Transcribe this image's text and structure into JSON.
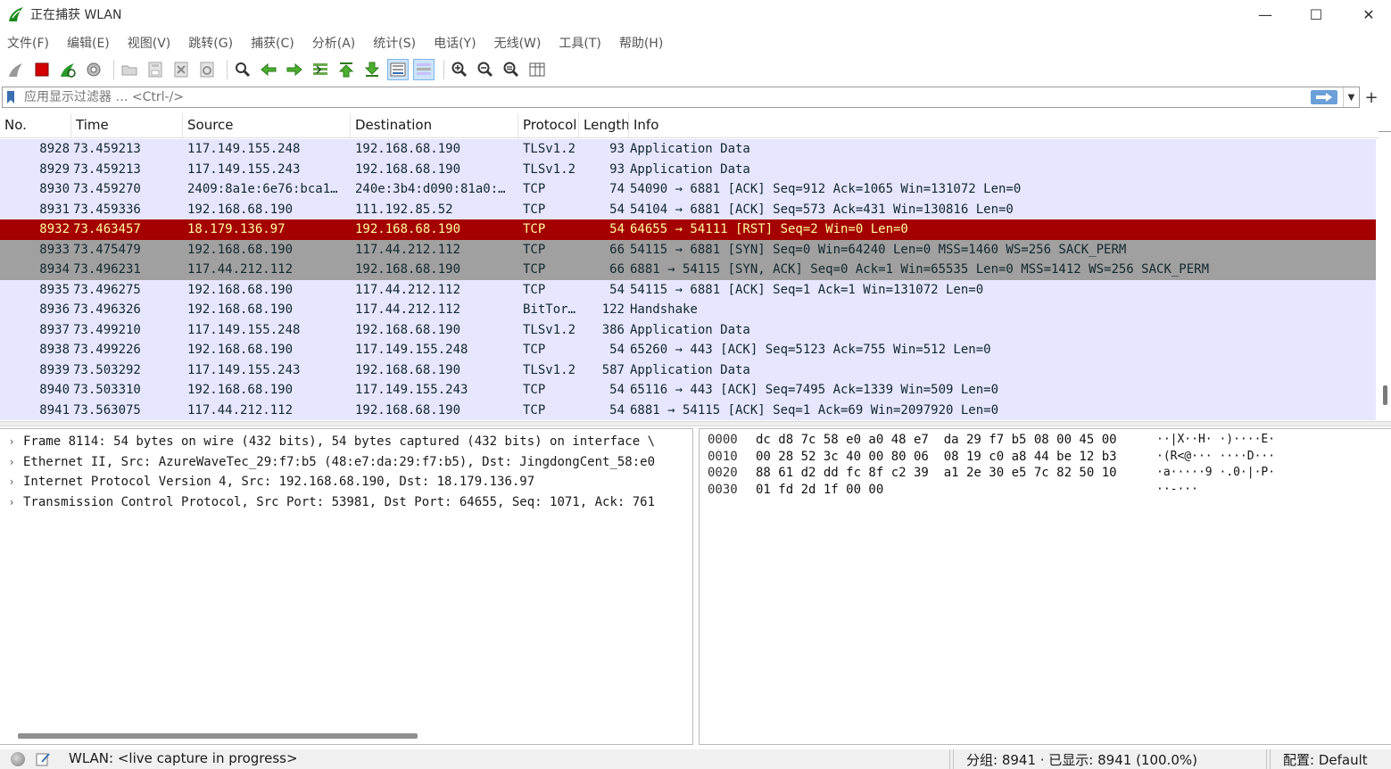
{
  "window": {
    "title": "正在捕获 WLAN",
    "minimize": "—",
    "maximize": "☐",
    "close": "✕"
  },
  "menu": [
    "文件(F)",
    "编辑(E)",
    "视图(V)",
    "跳转(G)",
    "捕获(C)",
    "分析(A)",
    "统计(S)",
    "电话(Y)",
    "无线(W)",
    "工具(T)",
    "帮助(H)"
  ],
  "toolbar": {
    "icons": [
      "shark-fin-start-icon",
      "stop-capture-icon",
      "restart-capture-icon",
      "capture-options-icon",
      "open-folder-icon",
      "save-file-icon",
      "close-file-icon",
      "reload-file-icon",
      "find-packet-icon",
      "go-back-icon",
      "go-forward-icon",
      "go-to-packet-icon",
      "go-first-icon",
      "go-last-icon",
      "autoscroll-icon",
      "colorize-icon",
      "zoom-in-icon",
      "zoom-out-icon",
      "zoom-normal-icon",
      "resize-columns-icon"
    ]
  },
  "filter": {
    "placeholder": "应用显示过滤器 … <Ctrl-/>",
    "add_label": "+"
  },
  "columns": {
    "no": "No.",
    "time": "Time",
    "source": "Source",
    "destination": "Destination",
    "protocol": "Protocol",
    "length": "Length",
    "info": "Info"
  },
  "packets": [
    {
      "no": "8928",
      "time": "73.459213",
      "src": "117.149.155.248",
      "dst": "192.168.68.190",
      "proto": "TLSv1.2",
      "len": "93",
      "info": "Application Data",
      "style": "tls"
    },
    {
      "no": "8929",
      "time": "73.459213",
      "src": "117.149.155.243",
      "dst": "192.168.68.190",
      "proto": "TLSv1.2",
      "len": "93",
      "info": "Application Data",
      "style": "tls"
    },
    {
      "no": "8930",
      "time": "73.459270",
      "src": "2409:8a1e:6e76:bca1…",
      "dst": "240e:3b4:d090:81a0:…",
      "proto": "TCP",
      "len": "74",
      "info": "54090 → 6881 [ACK] Seq=912 Ack=1065 Win=131072 Len=0",
      "style": "tcp"
    },
    {
      "no": "8931",
      "time": "73.459336",
      "src": "192.168.68.190",
      "dst": "111.192.85.52",
      "proto": "TCP",
      "len": "54",
      "info": "54104 → 6881 [ACK] Seq=573 Ack=431 Win=130816 Len=0",
      "style": "tcp"
    },
    {
      "no": "8932",
      "time": "73.463457",
      "src": "18.179.136.97",
      "dst": "192.168.68.190",
      "proto": "TCP",
      "len": "54",
      "info": "64655 → 54111 [RST] Seq=2 Win=0 Len=0",
      "style": "rst"
    },
    {
      "no": "8933",
      "time": "73.475479",
      "src": "192.168.68.190",
      "dst": "117.44.212.112",
      "proto": "TCP",
      "len": "66",
      "info": "54115 → 6881 [SYN] Seq=0 Win=64240 Len=0 MSS=1460 WS=256 SACK_PERM",
      "style": "syn"
    },
    {
      "no": "8934",
      "time": "73.496231",
      "src": "117.44.212.112",
      "dst": "192.168.68.190",
      "proto": "TCP",
      "len": "66",
      "info": "6881 → 54115 [SYN, ACK] Seq=0 Ack=1 Win=65535 Len=0 MSS=1412 WS=256 SACK_PERM",
      "style": "syn"
    },
    {
      "no": "8935",
      "time": "73.496275",
      "src": "192.168.68.190",
      "dst": "117.44.212.112",
      "proto": "TCP",
      "len": "54",
      "info": "54115 → 6881 [ACK] Seq=1 Ack=1 Win=131072 Len=0",
      "style": "tcp"
    },
    {
      "no": "8936",
      "time": "73.496326",
      "src": "192.168.68.190",
      "dst": "117.44.212.112",
      "proto": "BitTor…",
      "len": "122",
      "info": "Handshake",
      "style": "tcp"
    },
    {
      "no": "8937",
      "time": "73.499210",
      "src": "117.149.155.248",
      "dst": "192.168.68.190",
      "proto": "TLSv1.2",
      "len": "386",
      "info": "Application Data",
      "style": "tls"
    },
    {
      "no": "8938",
      "time": "73.499226",
      "src": "192.168.68.190",
      "dst": "117.149.155.248",
      "proto": "TCP",
      "len": "54",
      "info": "65260 → 443 [ACK] Seq=5123 Ack=755 Win=512 Len=0",
      "style": "tcp"
    },
    {
      "no": "8939",
      "time": "73.503292",
      "src": "117.149.155.243",
      "dst": "192.168.68.190",
      "proto": "TLSv1.2",
      "len": "587",
      "info": "Application Data",
      "style": "tls"
    },
    {
      "no": "8940",
      "time": "73.503310",
      "src": "192.168.68.190",
      "dst": "117.149.155.243",
      "proto": "TCP",
      "len": "54",
      "info": "65116 → 443 [ACK] Seq=7495 Ack=1339 Win=509 Len=0",
      "style": "tcp"
    },
    {
      "no": "8941",
      "time": "73.563075",
      "src": "117.44.212.112",
      "dst": "192.168.68.190",
      "proto": "TCP",
      "len": "54",
      "info": "6881 → 54115 [ACK] Seq=1 Ack=69 Win=2097920 Len=0",
      "style": "tcp"
    }
  ],
  "row_colors": {
    "tls": {
      "bg": "#e7e6ff",
      "fg": "#12272e"
    },
    "tcp": {
      "bg": "#e7e6ff",
      "fg": "#12272e"
    },
    "rst": {
      "bg": "#a40000",
      "fg": "#fffc9c"
    },
    "syn": {
      "bg": "#a0a0a0",
      "fg": "#12272e"
    }
  },
  "details": [
    "Frame 8114: 54 bytes on wire (432 bits), 54 bytes captured (432 bits) on interface \\",
    "Ethernet II, Src: AzureWaveTec_29:f7:b5 (48:e7:da:29:f7:b5), Dst: JingdongCent_58:e0",
    "Internet Protocol Version 4, Src: 192.168.68.190, Dst: 18.179.136.97",
    "Transmission Control Protocol, Src Port: 53981, Dst Port: 64655, Seq: 1071, Ack: 761"
  ],
  "details_expander": "›",
  "bytes": [
    {
      "offset": "0000",
      "hex": "dc d8 7c 58 e0 a0 48 e7  da 29 f7 b5 08 00 45 00",
      "ascii": "··|X··H· ·)····E·"
    },
    {
      "offset": "0010",
      "hex": "00 28 52 3c 40 00 80 06  08 19 c0 a8 44 be 12 b3",
      "ascii": "·(R<@··· ····D···"
    },
    {
      "offset": "0020",
      "hex": "88 61 d2 dd fc 8f c2 39  a1 2e 30 e5 7c 82 50 10",
      "ascii": "·a·····9 ·.0·|·P·"
    },
    {
      "offset": "0030",
      "hex": "01 fd 2d 1f 00 00",
      "ascii": "··-···"
    }
  ],
  "status": {
    "capture": "WLAN: <live capture in progress>",
    "packets": "分组: 8941 · 已显示: 8941 (100.0%)",
    "profile": "配置: Default"
  },
  "colors": {
    "accent": "#6a9fd8",
    "rst_bg": "#a40000",
    "rst_fg": "#fffc9c",
    "syn_bg": "#a0a0a0",
    "default_row_bg": "#e7e6ff"
  }
}
